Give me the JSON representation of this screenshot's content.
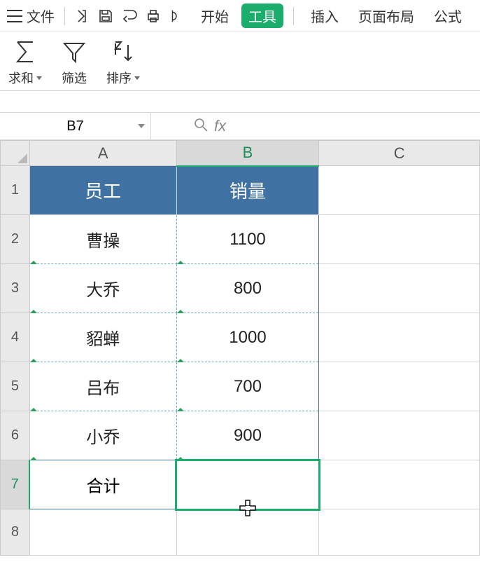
{
  "menubar": {
    "file_label": "文件",
    "tabs": {
      "start": "开始",
      "tools": "工具",
      "insert": "插入",
      "page_layout": "页面布局",
      "formulas": "公式"
    }
  },
  "ribbon": {
    "sum_label": "求和",
    "filter_label": "筛选",
    "sort_label": "排序"
  },
  "name_box": {
    "value": "B7"
  },
  "formula_bar": {
    "fx_label": "fx",
    "value": ""
  },
  "columns": {
    "A": "A",
    "B": "B",
    "C": "C"
  },
  "rows": {
    "r1": "1",
    "r2": "2",
    "r3": "3",
    "r4": "4",
    "r5": "5",
    "r6": "6",
    "r7": "7",
    "r8": "8"
  },
  "table_header": {
    "employee": "员工",
    "sales": "销量"
  },
  "table_rows": [
    {
      "employee": "曹操",
      "sales": "1100"
    },
    {
      "employee": "大乔",
      "sales": "800"
    },
    {
      "employee": "貂蝉",
      "sales": "1000"
    },
    {
      "employee": "吕布",
      "sales": "700"
    },
    {
      "employee": "小乔",
      "sales": "900"
    }
  ],
  "total_row": {
    "label": "合计",
    "value": ""
  },
  "selection": {
    "cell": "B7"
  }
}
